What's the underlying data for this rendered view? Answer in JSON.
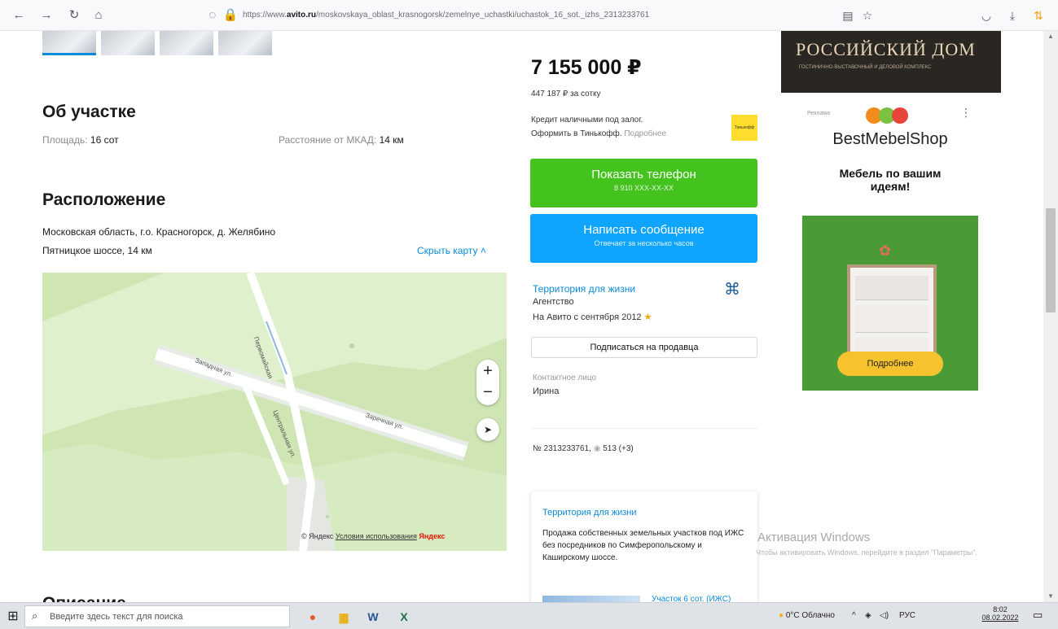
{
  "browser": {
    "url_prefix": "https://www.",
    "url_domain": "avito.ru",
    "url_path": "/moskovskaya_oblast_krasnogorsk/zemelnye_uchastki/uchastok_16_sot._izhs_2313233761"
  },
  "about": {
    "title": "Об участке",
    "area_label": "Площадь:",
    "area_value": "16 сот",
    "distance_label": "Расстояние от МКАД:",
    "distance_value": "14 км"
  },
  "location": {
    "title": "Расположение",
    "address": "Московская область, г.о. Красногорск, д. Желябино",
    "road": "Пятницкое шоссе, 14 км",
    "hide_map": "Скрыть карту"
  },
  "map": {
    "streets": [
      "Западная ул.",
      "Заречная ул.",
      "Центральная ул.",
      "Первомайская"
    ],
    "zoom_in": "+",
    "zoom_out": "−",
    "copyright": "© Яндекс",
    "terms": "Условия использования",
    "brand": "Яндекс"
  },
  "listing": {
    "price": "7 155 000 ₽",
    "per_are": "447 187 ₽ за сотку",
    "credit_line1": "Кредит наличными под залог.",
    "credit_line2": "Оформить в Тинькофф.",
    "credit_more": "Подробнее",
    "credit_badge": "Тинькофф",
    "phone_title": "Показать телефон",
    "phone_sub": "8 910 XXX-XX-XX",
    "msg_title": "Написать сообщение",
    "msg_sub": "Отвечает за несколько часов",
    "seller_name": "Территория для жизни",
    "seller_type": "Агентство",
    "seller_since": "На Авито с сентября 2012",
    "subscribe": "Подписаться на продавца",
    "contact_label": "Контактное лицо",
    "contact_name": "Ирина",
    "ad_number": "№ 2313233761,",
    "views": "513 (+3)"
  },
  "card": {
    "title": "Территория для жизни",
    "text": "Продажа собственных земельных участков под ИЖС без посредников по Симферопольскому и Каширскому шоссе.",
    "teaser": "Участок 6 сот. (ИЖС)"
  },
  "ads": {
    "banner_title": "РОССИЙСКИЙ ДОМ",
    "banner_sub": "ГОСТИНИЧНО-ВЫСТАВОЧНЫЙ И ДЕЛОВОЙ КОМПЛЕКС",
    "label": "Реклама",
    "shop": "BestMebelShop",
    "slogan": "Мебель по вашим идеям!",
    "cta": "Подробнее"
  },
  "windows": {
    "activation_title": "Активация Windows",
    "activation_text": "Чтобы активировать Windows, перейдите в раздел \"Параметры\".",
    "search_placeholder": "Введите здесь текст для поиска",
    "weather": "0°C Облачно",
    "lang": "РУС",
    "time": "8:02",
    "date": "08.02.2022"
  },
  "bottom": {
    "heading": "Описание"
  },
  "colors": {
    "green_button": "#44c21d",
    "blue_button": "#0fa5ff",
    "link": "#0a8ad8"
  }
}
